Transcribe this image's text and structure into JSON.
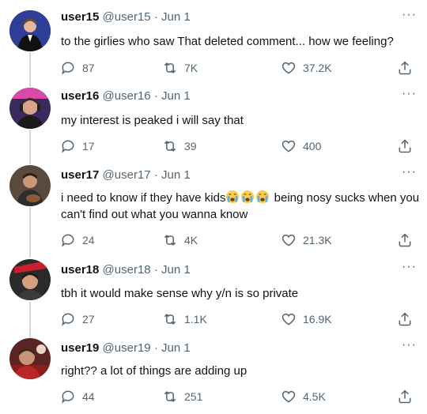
{
  "tweets": [
    {
      "username": "user15",
      "handle": "@user15",
      "date": "Jun 1",
      "text": "to the girlies who saw That deleted comment... how we feeling?",
      "replies": "87",
      "retweets": "7K",
      "likes": "37.2K"
    },
    {
      "username": "user16",
      "handle": "@user16",
      "date": "Jun 1",
      "text": "my interest is peaked i will say that",
      "replies": "17",
      "retweets": "39",
      "likes": "400"
    },
    {
      "username": "user17",
      "handle": "@user17",
      "date": "Jun 1",
      "text_before": "i need to know if they have kids",
      "text_after": " being nosy sucks when you can't find out what you wanna know",
      "emoji": "loudly-crying-face",
      "replies": "24",
      "retweets": "4K",
      "likes": "21.3K"
    },
    {
      "username": "user18",
      "handle": "@user18",
      "date": "Jun 1",
      "text": "tbh it would make sense why y/n is so private",
      "replies": "27",
      "retweets": "1.1K",
      "likes": "16.9K"
    },
    {
      "username": "user19",
      "handle": "@user19",
      "date": "Jun 1",
      "text": "right?? a lot of things are adding up",
      "replies": "44",
      "retweets": "251",
      "likes": "4.5K"
    }
  ],
  "ui": {
    "separator": "·",
    "more": "···"
  },
  "icons": {
    "reply": "reply-icon",
    "retweet": "retweet-icon",
    "like": "like-icon",
    "share": "share-icon"
  },
  "colors": {
    "text": "#0f1419",
    "muted": "#536471",
    "thread_line": "#cfd9de"
  }
}
